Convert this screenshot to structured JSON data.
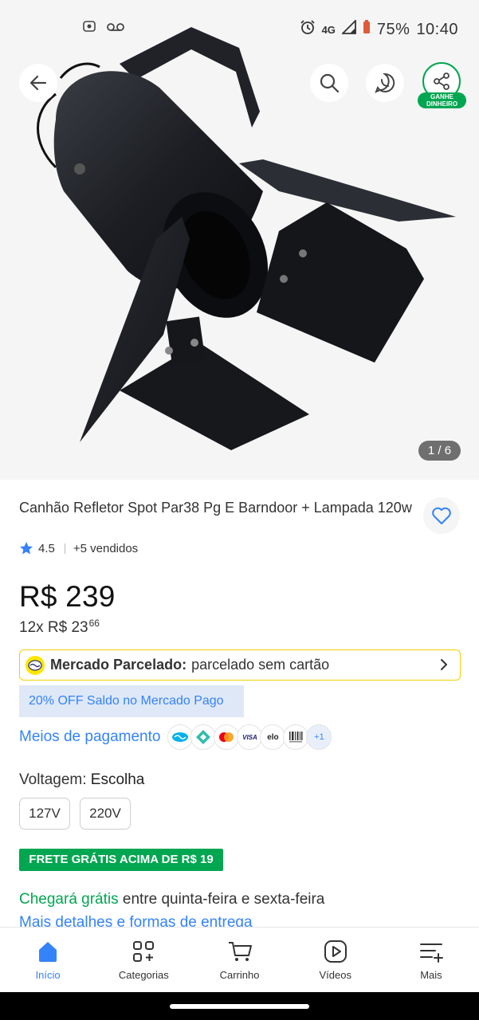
{
  "status_bar": {
    "network": "4G",
    "battery": "75%",
    "time": "10:40"
  },
  "gallery": {
    "counter": "1 / 6",
    "share_badge": "GANHE DINHEIRO"
  },
  "product": {
    "title": "Canhão Refletor Spot Par38 Pg E Barndoor + Lampada 120w",
    "rating": "4.5",
    "sold": "+5 vendidos",
    "price": "R$ 239",
    "installment_prefix": "12x R$ 23",
    "installment_cents": "66"
  },
  "mercado_parcelado": {
    "label": "Mercado Parcelado:",
    "text": "parcelado sem cartão"
  },
  "promo": "20% OFF Saldo no Mercado Pago",
  "payment": {
    "label": "Meios de pagamento",
    "elo": "elo",
    "visa": "VISA",
    "more": "+1"
  },
  "voltage": {
    "label": "Voltagem:",
    "value": "Escolha",
    "options": [
      "127V",
      "220V"
    ]
  },
  "shipping": {
    "badge": "FRETE GRÁTIS ACIMA DE R$ 19",
    "arrive_green": "Chegará grátis",
    "arrive_rest": "entre quinta-feira e sexta-feira",
    "more_link": "Mais detalhes e formas de entrega"
  },
  "tabbar": {
    "items": [
      {
        "label": "Início",
        "icon": "home-icon"
      },
      {
        "label": "Categorias",
        "icon": "categories-icon"
      },
      {
        "label": "Carrinho",
        "icon": "cart-icon"
      },
      {
        "label": "Vídeos",
        "icon": "video-icon"
      },
      {
        "label": "Mais",
        "icon": "menu-icon"
      }
    ]
  },
  "colors": {
    "brand_blue": "#3483fa",
    "green": "#00a650",
    "yellow": "#ffe600"
  }
}
